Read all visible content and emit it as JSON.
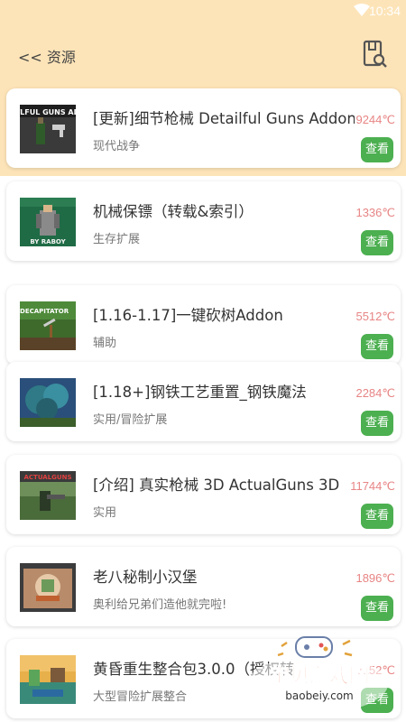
{
  "status_bar": {
    "time": "10:34"
  },
  "header": {
    "back_label": "<< 资源"
  },
  "items": [
    {
      "title": "[更新]细节枪械 Detailful Guns Addon",
      "tag": "现代战争",
      "heat": "9244℃",
      "button": "查看",
      "thumb_caption": "ATLFUL GUNS ADD"
    },
    {
      "title": "机械保镖（转载&索引）",
      "tag": "生存扩展",
      "heat": "1336℃",
      "button": "查看",
      "thumb_caption": "BY RABOY"
    },
    {
      "title": "[1.16-1.17]一键砍树Addon",
      "tag": "辅助",
      "heat": "5512℃",
      "button": "查看",
      "thumb_caption": "TREE DECAPITATOR"
    },
    {
      "title": "[1.18+]钢铁工艺重置_钢铁魔法",
      "tag": "实用/冒险扩展",
      "heat": "2284℃",
      "button": "查看",
      "thumb_caption": ""
    },
    {
      "title": "[介绍] 真实枪械 3D ActualGuns 3D",
      "tag": "实用",
      "heat": "11744℃",
      "button": "查看",
      "thumb_caption": "ACTUALGUNS"
    },
    {
      "title": "老八秘制小汉堡",
      "tag": "奥利给兄弟们造他就完啦!",
      "heat": "1896℃",
      "button": "查看",
      "thumb_caption": ""
    },
    {
      "title": "黄昏重生整合包3.0.0（授权转",
      "tag": "大型冒险扩展整合",
      "heat": "2152℃",
      "button": "查看",
      "thumb_caption": ""
    }
  ],
  "watermark": {
    "text": "宝贝游戏网",
    "url": "baobeiy.com"
  },
  "colors": {
    "header_bg": "#fde4b8",
    "view_button": "#4caf50",
    "heat_text": "#e88585"
  }
}
